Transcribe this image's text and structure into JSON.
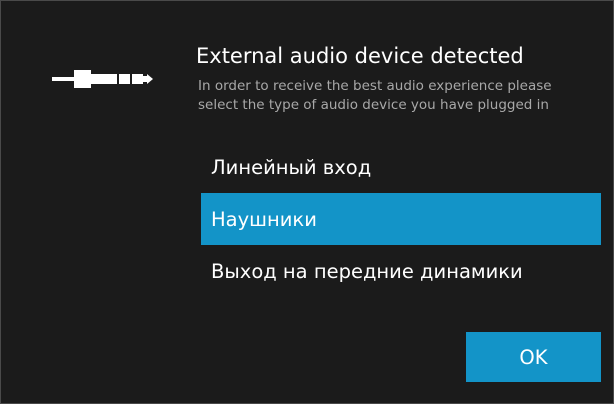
{
  "dialog": {
    "icon": "audio-jack-plug-icon",
    "title": "External audio device detected",
    "description_lines": [
      "In order to receive the best audio experience please",
      "select the type of audio device you have plugged in"
    ],
    "options": [
      {
        "label": "Линейный вход",
        "selected": false
      },
      {
        "label": "Наушники",
        "selected": true
      },
      {
        "label": "Выход на передние динамики",
        "selected": false
      }
    ],
    "ok_label": "OK"
  },
  "colors": {
    "background": "#1b1b1b",
    "accent": "#1394c8",
    "text": "#ffffff",
    "secondary_text": "#a8a8a8"
  }
}
